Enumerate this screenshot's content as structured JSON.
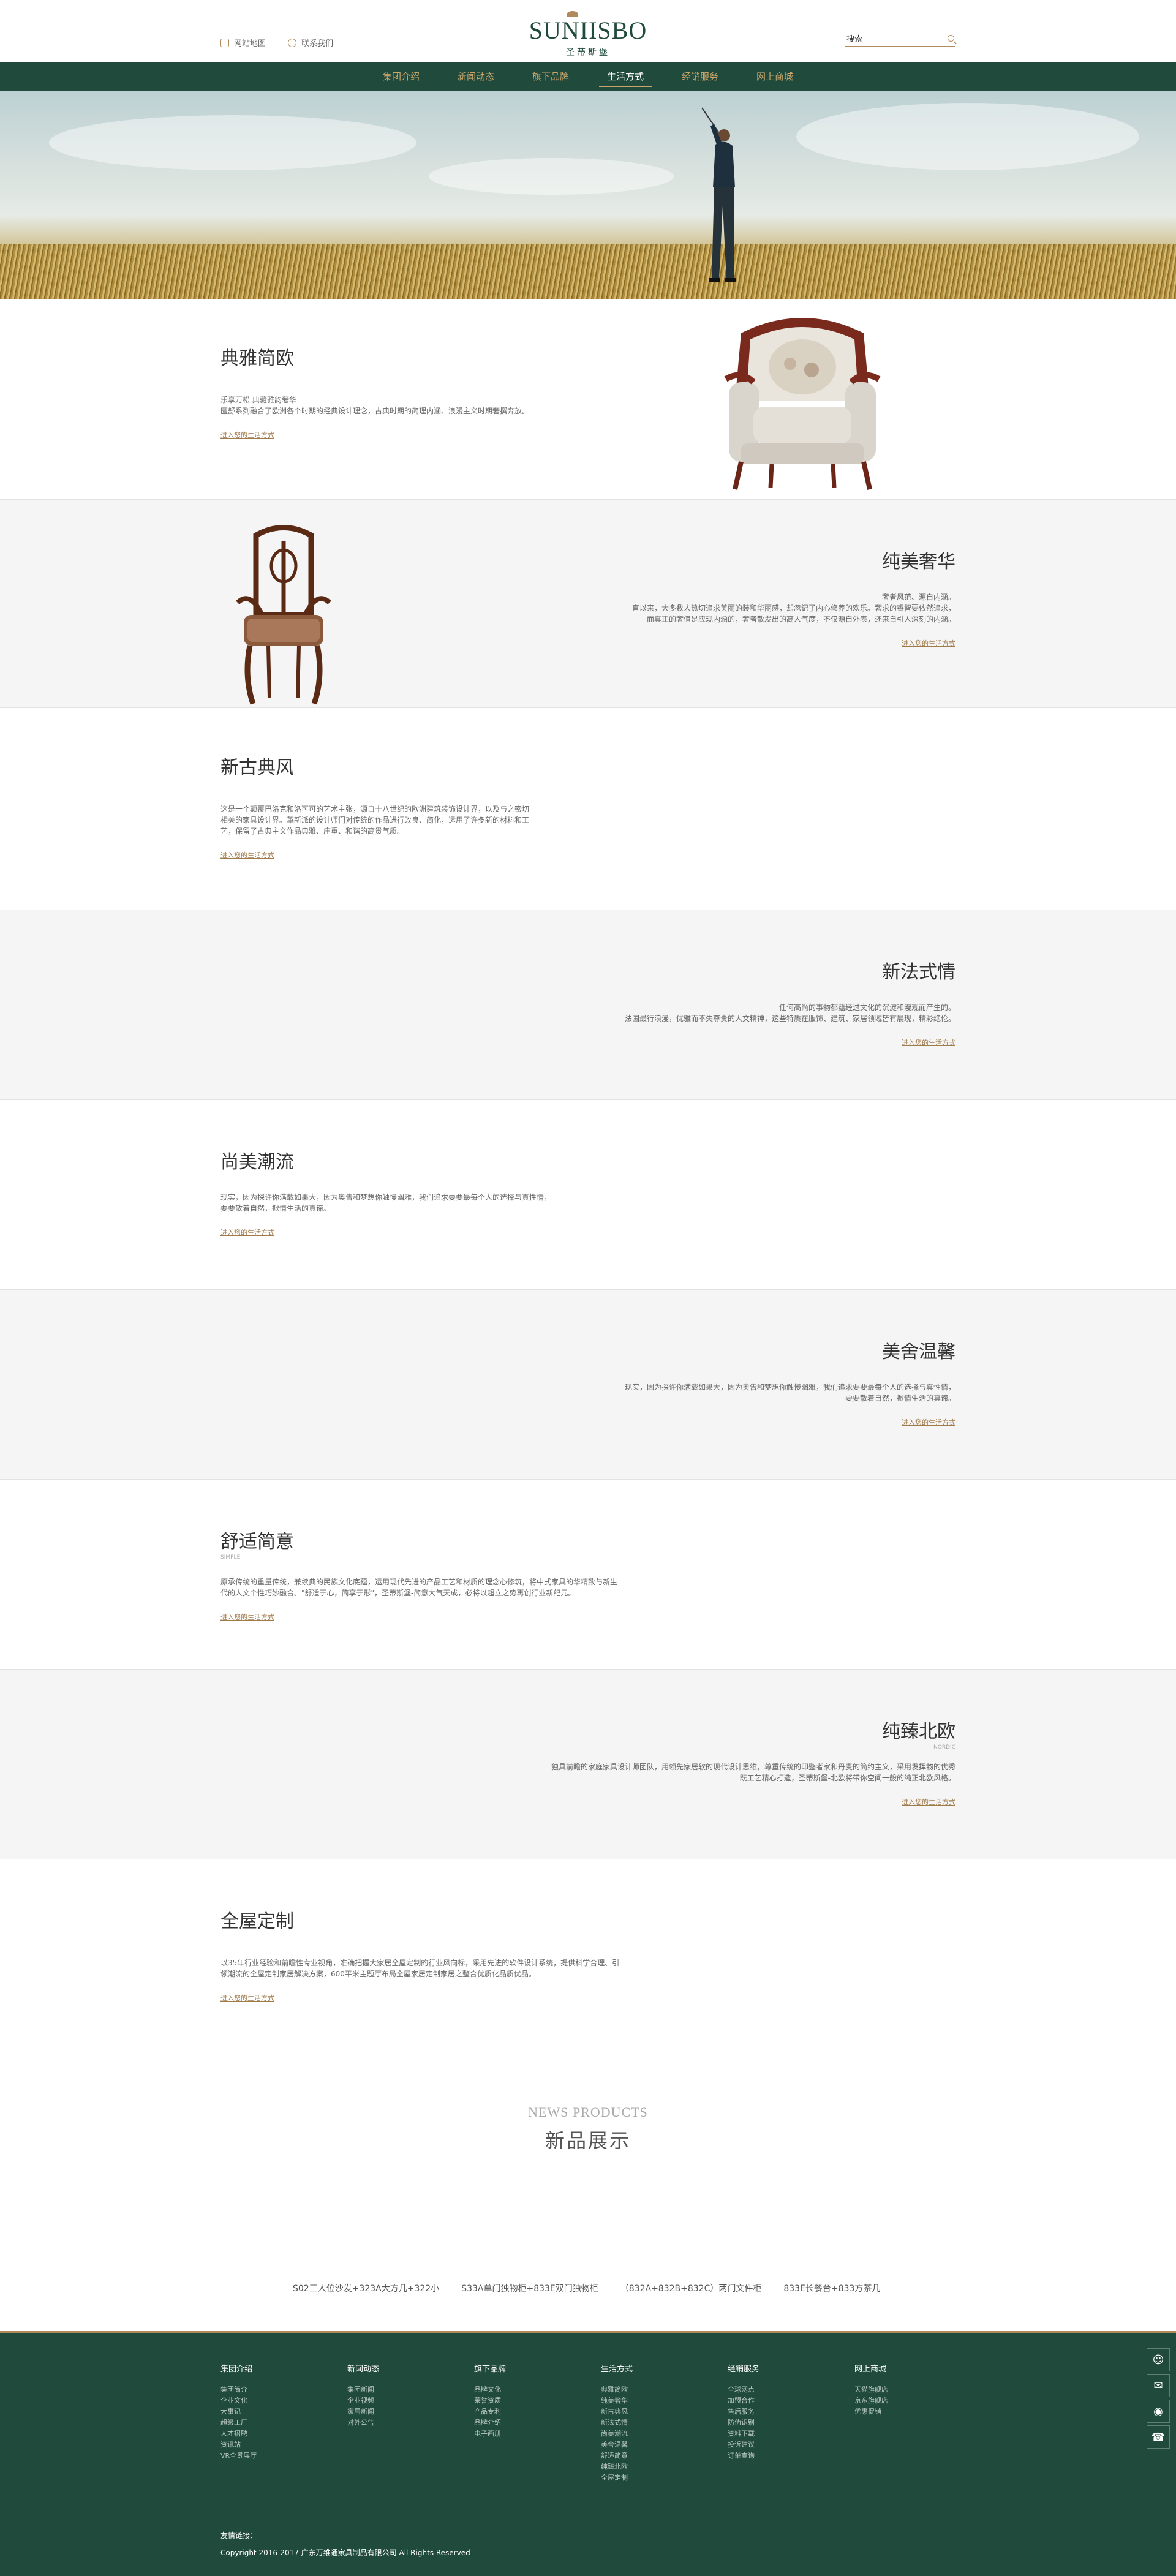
{
  "header": {
    "links": [
      {
        "icon": "map-icon",
        "label": "网站地图"
      },
      {
        "icon": "contact-icon",
        "label": "联系我们"
      }
    ],
    "logo_text": "SUNIISBO",
    "logo_sub": "圣蒂斯堡",
    "search_placeholder": "搜索"
  },
  "nav": {
    "items": [
      "集团介绍",
      "新闻动态",
      "旗下品牌",
      "生活方式",
      "经销服务",
      "网上商城"
    ],
    "active": "生活方式"
  },
  "sections": [
    {
      "title": "典雅简欧",
      "en": "",
      "lines": [
        "乐享万松 典藏雅韵奢华",
        "匿舒系列融合了欧洲各个时期的经典设计理念，古典时期的简理内涵、浪漫主义时期奢撰奔放。"
      ],
      "link": "进入您的生活方式",
      "align": "left",
      "image": "armchair"
    },
    {
      "title": "纯美奢华",
      "en": "",
      "lines": [
        "奢者风范、源自内涵。",
        "一直以来，大多数人热切追求美丽的装和华丽感，却忽记了内心修养的欢乐。奢求的睿智要依然追求，",
        "而真正的奢值是应现内涵的，奢者散发出的高人气度，不仅源自外表，还来自引人深刻的内涵。"
      ],
      "link": "进入您的生活方式",
      "align": "right",
      "image": "chair"
    },
    {
      "title": "新古典风",
      "en": "",
      "lines": [
        "这是一个颠覆巴洛克和洛可可的艺术主张，源自十八世纪的欧洲建筑装饰设计界，以及与之密切",
        "相关的家具设计界。革新派的设计师们对传统的作品进行改良、简化，运用了许多新的材料和工",
        "艺，保留了古典主义作品典雅、庄重、和谐的高贵气质。"
      ],
      "link": "进入您的生活方式",
      "align": "left",
      "image": ""
    },
    {
      "title": "新法式情",
      "en": "",
      "lines": [
        "任何高尚的事物都蕴经过文化的沉淀和漫观而产生的。",
        "法国最行浪漫，优雅而不失尊贵的人文精神，这些特质在服饰、建筑、家居领域皆有展现，精彩绝伦。"
      ],
      "link": "进入您的生活方式",
      "align": "right",
      "image": ""
    },
    {
      "title": "尚美潮流",
      "en": "",
      "lines": [
        "现实，因为探许你满载如果大，因为奥告和梦想你触慢幽雅，我们追求要要最每个人的选择与真性情，",
        "要要散着自然，掀情生活的真谛。"
      ],
      "link": "进入您的生活方式",
      "align": "left",
      "image": ""
    },
    {
      "title": "美舍温馨",
      "en": "",
      "lines": [
        "现实，因为探许你满载如果大，因为奥告和梦想你触慢幽雅，我们追求要要最每个人的选择与真性情，",
        "要要散着自然，掀情生活的真谛。"
      ],
      "link": "进入您的生活方式",
      "align": "right",
      "image": ""
    },
    {
      "title": "舒适简意",
      "en": "SIMPLE",
      "lines": [
        "原承传统的重量传统，兼续典的民族文化底蕴，运用现代先进的产品工艺和材质的理念心修筑，将中式家具的华精致与新生",
        "代的人文个性巧妙融合。\"舒适于心，简享于形\"，圣蒂斯堡-简意大气天成，必将以超立之势再创行业新纪元。"
      ],
      "link": "进入您的生活方式",
      "align": "left",
      "image": ""
    },
    {
      "title": "纯臻北欧",
      "en": "NORDIC",
      "lines": [
        "独具前瞻的家庭家具设计师团队，用领先家居软的现代设计思维，尊重传统的印鉴者家和丹麦的简约主义，采用发挥物的优秀",
        "既工艺精心打造，圣蒂斯堡-北欧将带你空间一般的纯正北欧风格。"
      ],
      "link": "进入您的生活方式",
      "align": "right",
      "image": ""
    },
    {
      "title": "全屋定制",
      "en": "",
      "lines": [
        "以35年行业经验和前瞻性专业视角，准确把握大家居全屋定制的行业风向标，采用先进的软件设计系统，提供科学合理、引",
        "领潮流的全屋定制家居解决方案，600平米主题厅布局全屋家居定制家居之整合优质化品质优品。"
      ],
      "link": "进入您的生活方式",
      "align": "left",
      "image": ""
    }
  ],
  "news": {
    "en": "NEWS PRODUCTS",
    "cn": "新品展示",
    "products": [
      "S02三人位沙发+323A大方几+322小",
      "S33A单门独物柜+833E双门独物柜",
      "（832A+832B+832C）两门文件柜",
      "833E长餐台+833方茶几"
    ]
  },
  "footer": {
    "columns": [
      {
        "title": "集团介绍",
        "items": [
          "集团简介",
          "企业文化",
          "大事记",
          "超级工厂",
          "人才招聘",
          "资讯站",
          "VR全景展厅"
        ]
      },
      {
        "title": "新闻动态",
        "items": [
          "集团新闻",
          "企业视频",
          "家居新闻",
          "对外公告"
        ]
      },
      {
        "title": "旗下品牌",
        "items": [
          "品牌文化",
          "荣誉资质",
          "产品专利",
          "品牌介绍",
          "电子画册"
        ]
      },
      {
        "title": "生活方式",
        "items": [
          "典雅简欧",
          "纯美奢华",
          "新古典风",
          "新法式情",
          "尚美潮流",
          "美舍温馨",
          "舒适简意",
          "纯臻北欧",
          "全屋定制"
        ]
      },
      {
        "title": "经销服务",
        "items": [
          "全球网点",
          "加盟合作",
          "售后服务",
          "防伪识别",
          "资料下载",
          "投诉建议",
          "订单查询"
        ]
      },
      {
        "title": "网上商城",
        "items": [
          "天猫旗舰店",
          "京东旗舰店",
          "优惠促销"
        ]
      }
    ],
    "friend_label": "友情链接：",
    "copyright": "Copyright 2016-2017 广东万维通家具制品有限公司 All Rights Reserved"
  },
  "side_tools": [
    {
      "icon": "qq-icon"
    },
    {
      "icon": "wechat-icon"
    },
    {
      "icon": "weibo-icon"
    },
    {
      "icon": "phone-icon"
    }
  ],
  "colors": {
    "brand_green": "#1f4a3c",
    "accent_gold": "#b08a5a"
  }
}
